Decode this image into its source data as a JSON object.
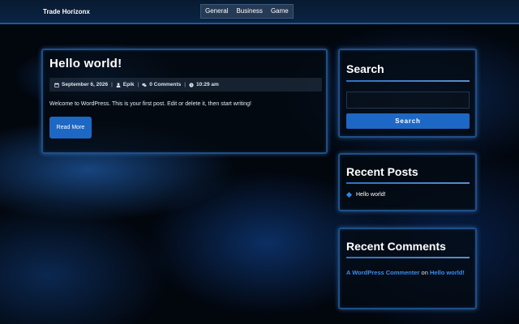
{
  "header": {
    "site_title": "Trade Horizonx",
    "nav": [
      "General",
      "Business",
      "Game"
    ]
  },
  "post": {
    "title": "Hello world!",
    "date": "September 6, 2026",
    "author": "Epik",
    "comments": "0 Comments",
    "time": "10:29 am",
    "excerpt": "Welcome to WordPress. This is your first post. Edit or delete it, then start writing!",
    "read_more": "Read More"
  },
  "search_widget": {
    "title": "Search",
    "input_value": "",
    "button_label": "Search"
  },
  "recent_posts": {
    "title": "Recent Posts",
    "items": [
      "Hello world!"
    ]
  },
  "recent_comments": {
    "title": "Recent Comments",
    "author": "A WordPress Commenter",
    "on": "on",
    "post": "Hello world!"
  },
  "colors": {
    "accent": "#1d68c4",
    "link": "#3b8df0",
    "card_border": "#1f4f86"
  }
}
